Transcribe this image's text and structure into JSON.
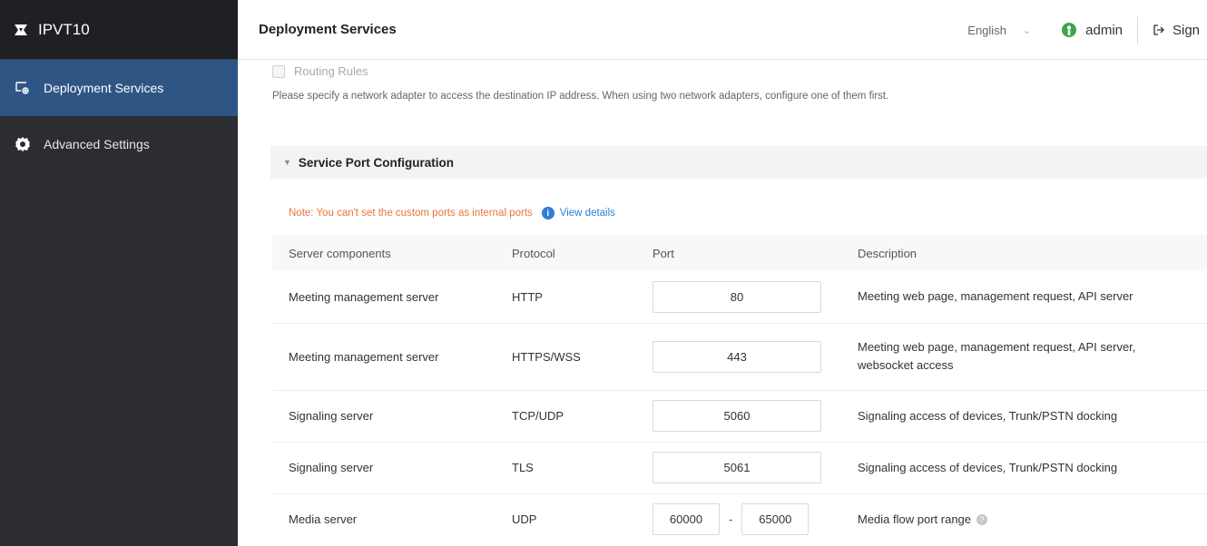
{
  "app": {
    "brand": "IPVT10"
  },
  "sidebar": {
    "items": [
      {
        "label": "Deployment Services",
        "icon": "monitor-gear-icon",
        "active": true
      },
      {
        "label": "Advanced Settings",
        "icon": "gear-icon",
        "active": false
      }
    ]
  },
  "header": {
    "title": "Deployment Services",
    "language": "English",
    "user": "admin",
    "signout_label": "Sign"
  },
  "routing": {
    "label": "Routing Rules",
    "hint": "Please specify a network adapter to access the destination IP address. When using two network adapters, configure one of them first."
  },
  "section": {
    "title": "Service Port Configuration"
  },
  "note": {
    "text": "Note: You can't set the custom ports as internal ports",
    "link": "View details"
  },
  "table": {
    "headers": [
      "Server components",
      "Protocol",
      "Port",
      "Description"
    ],
    "rows": [
      {
        "component": "Meeting management server",
        "protocol": "HTTP",
        "port": "80",
        "description": "Meeting web page, management request, API server"
      },
      {
        "component": "Meeting management server",
        "protocol": "HTTPS/WSS",
        "port": "443",
        "description": "Meeting web page, management request, API server, websocket access"
      },
      {
        "component": "Signaling server",
        "protocol": "TCP/UDP",
        "port": "5060",
        "description": "Signaling access of devices, Trunk/PSTN docking"
      },
      {
        "component": "Signaling server",
        "protocol": "TLS",
        "port": "5061",
        "description": "Signaling access of devices, Trunk/PSTN docking"
      },
      {
        "component": "Media server",
        "protocol": "UDP",
        "port_from": "60000",
        "port_to": "65000",
        "range_sep": "-",
        "description": "Media flow port range"
      }
    ]
  },
  "colors": {
    "sidebar_bg": "#2b2d33",
    "active_item": "#2f5585",
    "note": "#e8743b",
    "link": "#2d7ed6"
  }
}
